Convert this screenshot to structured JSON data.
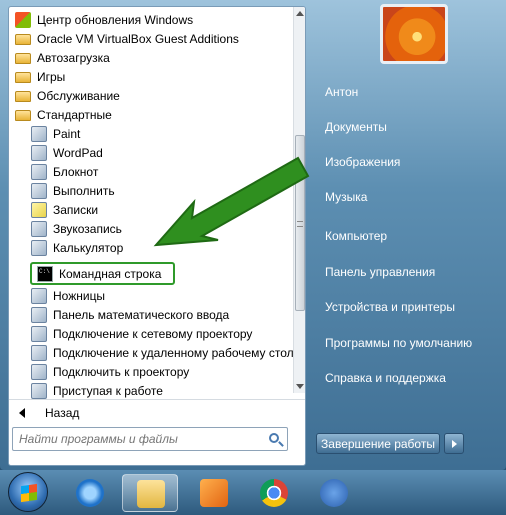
{
  "programs": [
    {
      "label": "Центр обновления Windows",
      "icon": "windows-update-icon"
    },
    {
      "label": "Oracle VM VirtualBox Guest Additions",
      "icon": "folder-icon"
    },
    {
      "label": "Автозагрузка",
      "icon": "folder-icon"
    },
    {
      "label": "Игры",
      "icon": "folder-icon"
    },
    {
      "label": "Обслуживание",
      "icon": "folder-icon"
    },
    {
      "label": "Стандартные",
      "icon": "folder-open-icon"
    },
    {
      "label": "Paint",
      "icon": "paint-icon"
    },
    {
      "label": "WordPad",
      "icon": "wordpad-icon"
    },
    {
      "label": "Блокнот",
      "icon": "notepad-icon"
    },
    {
      "label": "Выполнить",
      "icon": "run-icon"
    },
    {
      "label": "Записки",
      "icon": "sticky-notes-icon"
    },
    {
      "label": "Звукозапись",
      "icon": "microphone-icon"
    },
    {
      "label": "Калькулятор",
      "icon": "calculator-icon"
    },
    {
      "label": "Командная строка",
      "icon": "command-prompt-icon"
    },
    {
      "label": "Ножницы",
      "icon": "scissors-icon"
    },
    {
      "label": "Панель математического ввода",
      "icon": "math-input-icon"
    },
    {
      "label": "Подключение к сетевому проектору",
      "icon": "network-projector-icon"
    },
    {
      "label": "Подключение к удаленному рабочему столу",
      "icon": "remote-desktop-icon"
    },
    {
      "label": "Подключить к проектору",
      "icon": "projector-icon"
    },
    {
      "label": "Приступая к работе",
      "icon": "getting-started-icon"
    }
  ],
  "back_label": "Назад",
  "search": {
    "placeholder": "Найти программы и файлы"
  },
  "right": {
    "user": "Антон",
    "links": [
      "Документы",
      "Изображения",
      "Музыка",
      "Компьютер",
      "Панель управления",
      "Устройства и принтеры",
      "Программы по умолчанию",
      "Справка и поддержка"
    ],
    "shutdown_label": "Завершение работы"
  },
  "taskbar": [
    "start-orb",
    "internet-explorer-icon",
    "explorer-icon",
    "media-player-icon",
    "chrome-icon",
    "qbittorrent-icon"
  ],
  "colors": {
    "highlight": "#2f9a2a",
    "arrow": "#2f8f1f"
  }
}
